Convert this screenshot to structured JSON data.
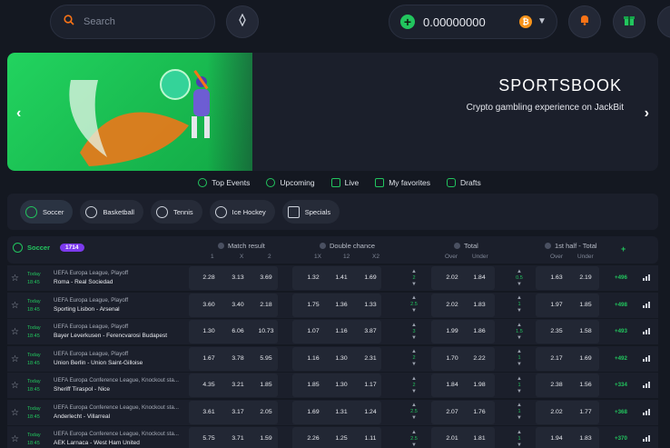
{
  "search": {
    "placeholder": "Search"
  },
  "balance": {
    "amount": "0.00000000",
    "currency_icon": "bitcoin-icon"
  },
  "banner": {
    "title": "SPORTSBOOK",
    "subtitle": "Crypto gambling experience on JackBit"
  },
  "tabs": [
    {
      "label": "Top Events",
      "icon": "trophy-icon"
    },
    {
      "label": "Upcoming",
      "icon": "clock-icon"
    },
    {
      "label": "Live",
      "icon": "live-icon"
    },
    {
      "label": "My favorites",
      "icon": "star-icon"
    },
    {
      "label": "Drafts",
      "icon": "draft-icon"
    }
  ],
  "sports": [
    {
      "label": "Soccer",
      "icon": "soccer-icon",
      "active": true
    },
    {
      "label": "Basketball",
      "icon": "basketball-icon",
      "active": false
    },
    {
      "label": "Tennis",
      "icon": "tennis-icon",
      "active": false
    },
    {
      "label": "Ice Hockey",
      "icon": "hockey-icon",
      "active": false
    },
    {
      "label": "Specials",
      "icon": "chart-icon",
      "active": false
    }
  ],
  "table_header": {
    "sport": "Soccer",
    "count": "1714",
    "groups": [
      {
        "label": "Match result",
        "subs": [
          "1",
          "X",
          "2"
        ]
      },
      {
        "label": "Double chance",
        "subs": [
          "1X",
          "12",
          "X2"
        ]
      },
      {
        "label": "Total",
        "subs": [
          "Over",
          "Under"
        ]
      },
      {
        "label": "1st half - Total",
        "subs": [
          "Over",
          "Under"
        ]
      }
    ],
    "plus": "+"
  },
  "events": [
    {
      "day": "Today",
      "time": "18:45",
      "league": "UEFA Europa League, Playoff",
      "teams": "Roma - Real Sociedad",
      "mr": [
        "2.28",
        "3.13",
        "3.69"
      ],
      "dc": [
        "1.32",
        "1.41",
        "1.69"
      ],
      "total_line": "2",
      "total": [
        "2.02",
        "1.84"
      ],
      "half_line": "0.5",
      "half": [
        "1.63",
        "2.19"
      ],
      "more": "+496"
    },
    {
      "day": "Today",
      "time": "18:45",
      "league": "UEFA Europa League, Playoff",
      "teams": "Sporting Lisbon - Arsenal",
      "mr": [
        "3.60",
        "3.40",
        "2.18"
      ],
      "dc": [
        "1.75",
        "1.36",
        "1.33"
      ],
      "total_line": "2.5",
      "total": [
        "2.02",
        "1.83"
      ],
      "half_line": "1",
      "half": [
        "1.97",
        "1.85"
      ],
      "more": "+498"
    },
    {
      "day": "Today",
      "time": "18:45",
      "league": "UEFA Europa League, Playoff",
      "teams": "Bayer Leverkusen - Ferencvarosi Budapest",
      "mr": [
        "1.30",
        "6.06",
        "10.73"
      ],
      "dc": [
        "1.07",
        "1.16",
        "3.87"
      ],
      "total_line": "3",
      "total": [
        "1.99",
        "1.86"
      ],
      "half_line": "1.5",
      "half": [
        "2.35",
        "1.58"
      ],
      "more": "+493"
    },
    {
      "day": "Today",
      "time": "18:45",
      "league": "UEFA Europa League, Playoff",
      "teams": "Union Berlin - Union Saint-Gilloise",
      "mr": [
        "1.67",
        "3.78",
        "5.95"
      ],
      "dc": [
        "1.16",
        "1.30",
        "2.31"
      ],
      "total_line": "2",
      "total": [
        "1.70",
        "2.22"
      ],
      "half_line": "1",
      "half": [
        "2.17",
        "1.69"
      ],
      "more": "+492"
    },
    {
      "day": "Today",
      "time": "18:45",
      "league": "UEFA Europa Conference League, Knockout sta...",
      "teams": "Sheriff Tiraspol - Nice",
      "mr": [
        "4.35",
        "3.21",
        "1.85"
      ],
      "dc": [
        "1.85",
        "1.30",
        "1.17"
      ],
      "total_line": "2",
      "total": [
        "1.84",
        "1.98"
      ],
      "half_line": "1",
      "half": [
        "2.38",
        "1.56"
      ],
      "more": "+334"
    },
    {
      "day": "Today",
      "time": "18:45",
      "league": "UEFA Europa Conference League, Knockout sta...",
      "teams": "Anderlecht - Villarreal",
      "mr": [
        "3.61",
        "3.17",
        "2.05"
      ],
      "dc": [
        "1.69",
        "1.31",
        "1.24"
      ],
      "total_line": "2.5",
      "total": [
        "2.07",
        "1.76"
      ],
      "half_line": "1",
      "half": [
        "2.02",
        "1.77"
      ],
      "more": "+368"
    },
    {
      "day": "Today",
      "time": "18:45",
      "league": "UEFA Europa Conference League, Knockout sta...",
      "teams": "AEK Larnaca - West Ham United",
      "mr": [
        "5.75",
        "3.71",
        "1.59"
      ],
      "dc": [
        "2.26",
        "1.25",
        "1.11"
      ],
      "total_line": "2.5",
      "total": [
        "2.01",
        "1.81"
      ],
      "half_line": "1",
      "half": [
        "1.94",
        "1.83"
      ],
      "more": "+370"
    }
  ]
}
